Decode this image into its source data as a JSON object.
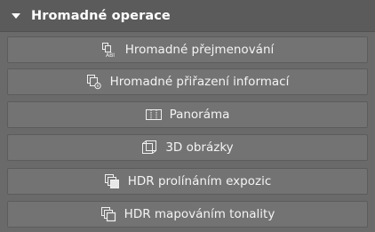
{
  "section": {
    "title": "Hromadné operace",
    "expanded": true
  },
  "buttons": [
    {
      "label": "Hromadné přejmenování",
      "icon": "batch-rename-icon"
    },
    {
      "label": "Hromadné přiřazení informací",
      "icon": "batch-metadata-icon"
    },
    {
      "label": "Panoráma",
      "icon": "panorama-icon"
    },
    {
      "label": "3D obrázky",
      "icon": "3d-image-icon"
    },
    {
      "label": "HDR prolínáním expozic",
      "icon": "hdr-exposure-blend-icon"
    },
    {
      "label": "HDR mapováním tonality",
      "icon": "hdr-tone-mapping-icon"
    }
  ],
  "colors": {
    "panel_bg": "#6a6a6a",
    "header_bg": "#5b5b5b",
    "button_bg": "#737373",
    "text": "#f4f4f4"
  }
}
